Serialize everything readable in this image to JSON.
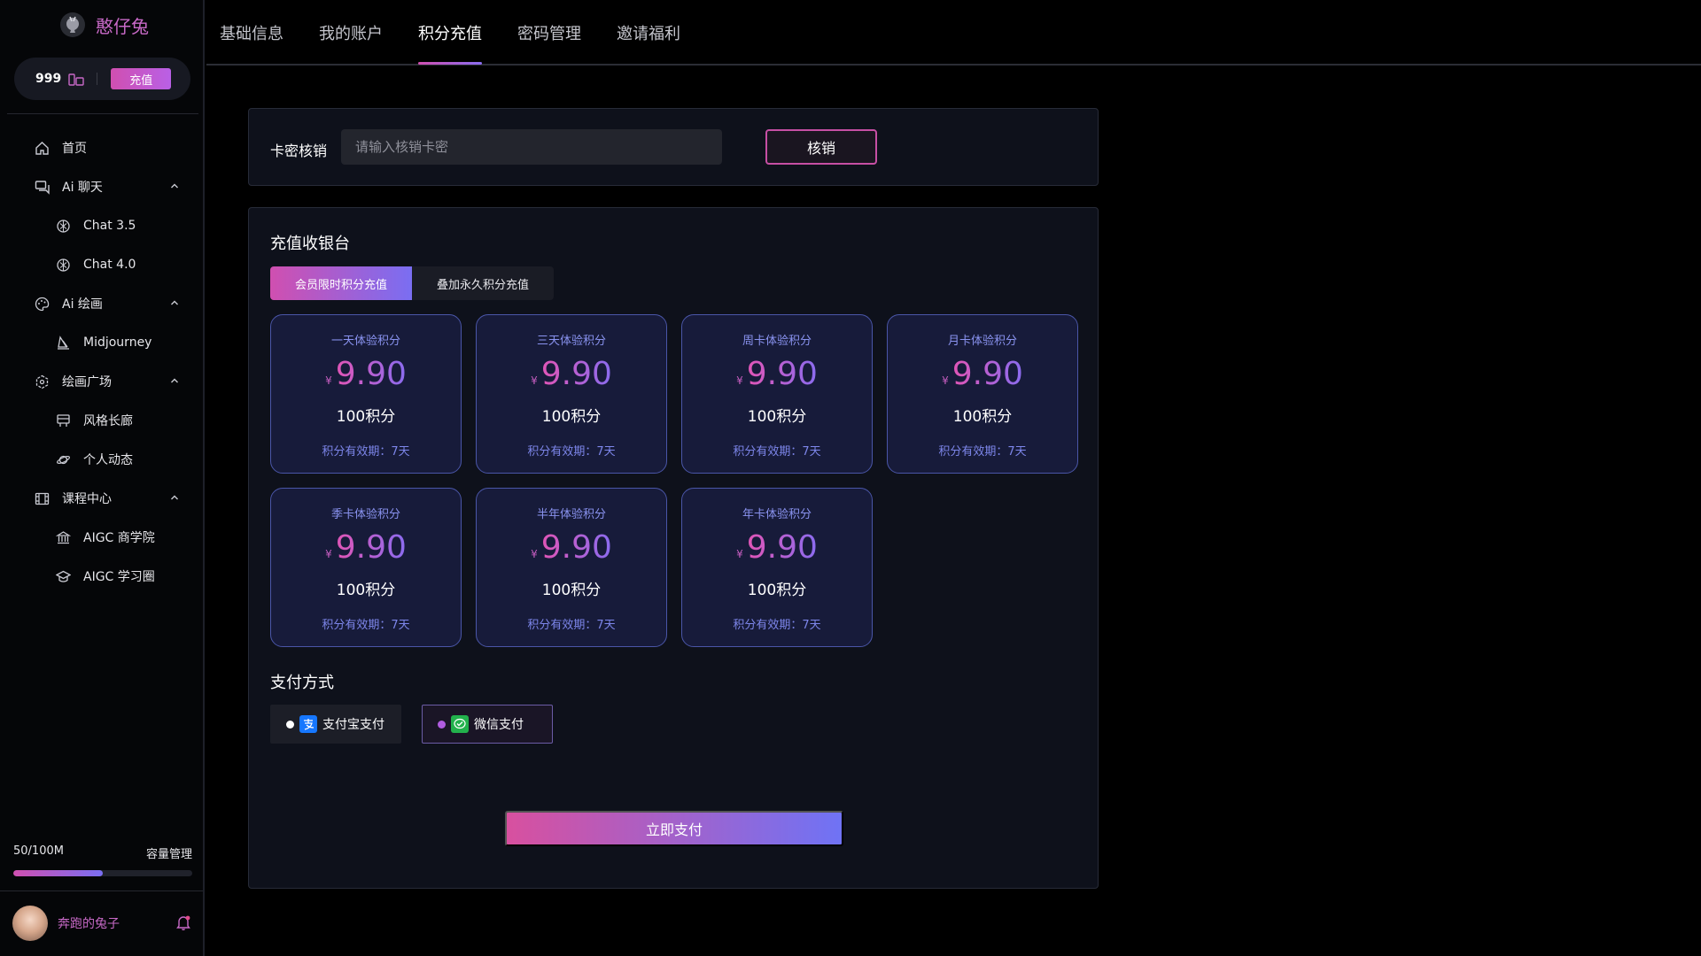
{
  "brand": {
    "name": "憨仔兔"
  },
  "balance": {
    "points": "999",
    "topup_label": "充值"
  },
  "nav": {
    "items": [
      {
        "label": "首页",
        "icon": "home-icon",
        "level": "top"
      },
      {
        "label": "Ai 聊天",
        "icon": "chat-icon",
        "level": "top",
        "expanded": true
      },
      {
        "label": "Chat 3.5",
        "icon": "openai-icon",
        "level": "sub"
      },
      {
        "label": "Chat 4.0",
        "icon": "openai-icon",
        "level": "sub"
      },
      {
        "label": "Ai 绘画",
        "icon": "palette-icon",
        "level": "top",
        "expanded": true
      },
      {
        "label": "Midjourney",
        "icon": "sail-icon",
        "level": "sub"
      },
      {
        "label": "绘画广场",
        "icon": "hexagon-icon",
        "level": "top",
        "expanded": true
      },
      {
        "label": "风格长廊",
        "icon": "easel-icon",
        "level": "sub"
      },
      {
        "label": "个人动态",
        "icon": "planet-icon",
        "level": "sub"
      },
      {
        "label": "课程中心",
        "icon": "film-icon",
        "level": "top",
        "expanded": true
      },
      {
        "label": "AIGC 商学院",
        "icon": "bank-icon",
        "level": "sub"
      },
      {
        "label": "AIGC 学习圈",
        "icon": "graduation-cap-icon",
        "level": "sub"
      }
    ]
  },
  "storage": {
    "usage": "50/100M",
    "manage_label": "容量管理",
    "fill_percent": 50
  },
  "user": {
    "name": "奔跑的兔子"
  },
  "tabs": {
    "items": [
      {
        "label": "基础信息"
      },
      {
        "label": "我的账户"
      },
      {
        "label": "积分充值",
        "active": true
      },
      {
        "label": "密码管理"
      },
      {
        "label": "邀请福利"
      }
    ]
  },
  "redeem": {
    "label": "卡密核销",
    "placeholder": "请输入核销卡密",
    "value": "",
    "button_label": "核销"
  },
  "cashier": {
    "title": "充值收银台",
    "segments": [
      {
        "label": "会员限时积分充值",
        "active": true
      },
      {
        "label": "叠加永久积分充值",
        "active": false
      }
    ],
    "plans": [
      {
        "name": "一天体验积分",
        "currency": "¥",
        "price": "9.90",
        "points": "100积分",
        "validity": "积分有效期：7天"
      },
      {
        "name": "三天体验积分",
        "currency": "¥",
        "price": "9.90",
        "points": "100积分",
        "validity": "积分有效期：7天"
      },
      {
        "name": "周卡体验积分",
        "currency": "¥",
        "price": "9.90",
        "points": "100积分",
        "validity": "积分有效期：7天"
      },
      {
        "name": "月卡体验积分",
        "currency": "¥",
        "price": "9.90",
        "points": "100积分",
        "validity": "积分有效期：7天"
      },
      {
        "name": "季卡体验积分",
        "currency": "¥",
        "price": "9.90",
        "points": "100积分",
        "validity": "积分有效期：7天"
      },
      {
        "name": "半年体验积分",
        "currency": "¥",
        "price": "9.90",
        "points": "100积分",
        "validity": "积分有效期：7天"
      },
      {
        "name": "年卡体验积分",
        "currency": "¥",
        "price": "9.90",
        "points": "100积分",
        "validity": "积分有效期：7天"
      }
    ],
    "payment": {
      "title": "支付方式",
      "options": [
        {
          "label": "支付宝支付",
          "icon": "alipay-icon",
          "selected": false
        },
        {
          "label": "微信支付",
          "icon": "wechat-pay-icon",
          "selected": true
        }
      ]
    },
    "pay_button_label": "立即支付"
  },
  "colors": {
    "accent_pink": "#d04fb0",
    "accent_violet": "#7a6ef2",
    "plan_border": "#4a56a8",
    "plan_bg": "#171b3a",
    "brand_text": "#c869c7"
  }
}
